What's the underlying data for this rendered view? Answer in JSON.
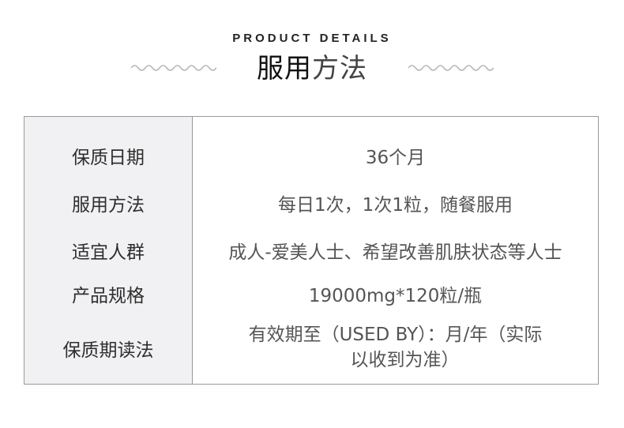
{
  "header": {
    "eyebrow": "PRODUCT DETAILS",
    "title_strong": "服用",
    "title_light": "方法"
  },
  "rows": [
    {
      "label": "保质日期",
      "value": "36个月"
    },
    {
      "label": "服用方法",
      "value": "每日1次，1次1粒，随餐服用"
    },
    {
      "label": "适宜人群",
      "value": "成人-爱美人士、希望改善肌肤状态等人士"
    },
    {
      "label": "产品规格",
      "value": "19000mg*120粒/瓶"
    },
    {
      "label": "保质期读法",
      "value_line1": "有效期至（USED BY）：月/年（实际",
      "value_line2": "以收到为准）"
    }
  ],
  "colors": {
    "label_bg": "#f1f1f3",
    "border": "#9a9a9a",
    "wave": "#b5b5b5"
  }
}
